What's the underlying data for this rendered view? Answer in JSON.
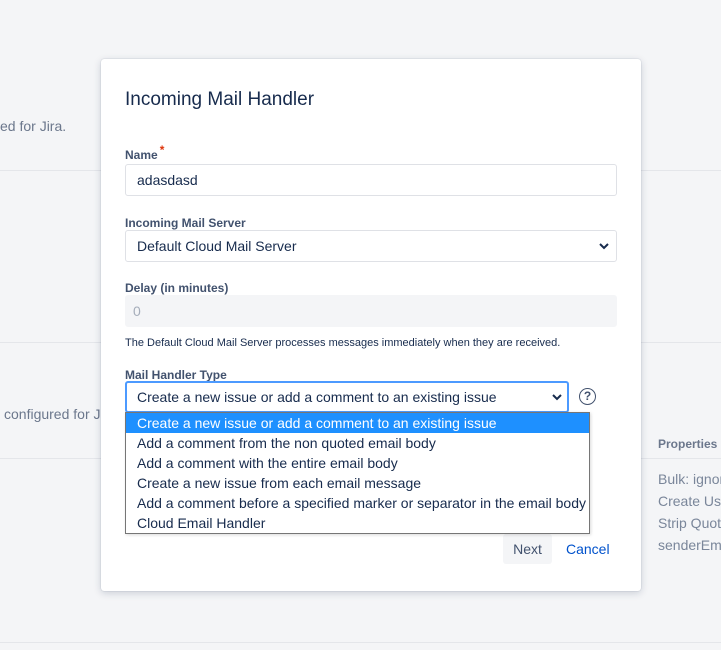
{
  "background": {
    "snippet1": "ed for Jira.",
    "snippet2": "configured for J",
    "properties": {
      "header": "Properties",
      "rows": [
        "Bulk: ignor",
        "Create Use",
        "Strip Quot",
        "senderEma"
      ]
    }
  },
  "dialog": {
    "title": "Incoming Mail Handler",
    "name": {
      "label": "Name",
      "required_marker": "*",
      "value": "adasdasd"
    },
    "server": {
      "label": "Incoming Mail Server",
      "value": "Default Cloud Mail Server"
    },
    "delay": {
      "label": "Delay (in minutes)",
      "value": "0"
    },
    "help_text": "The Default Cloud Mail Server processes messages immediately when they are received.",
    "handler_type": {
      "label": "Mail Handler Type",
      "value": "Create a new issue or add a comment to an existing issue",
      "options": [
        "Create a new issue or add a comment to an existing issue",
        "Add a comment from the non quoted email body",
        "Add a comment with the entire email body",
        "Create a new issue from each email message",
        "Add a comment before a specified marker or separator in the email body",
        "Cloud Email Handler"
      ],
      "selected_index": 0
    },
    "help_icon": "question-circle-icon",
    "next_label": "Next",
    "cancel_label": "Cancel"
  },
  "colors": {
    "accent": "#4c9aff",
    "selected_option": "#1e90ff",
    "link": "#0052cc",
    "required": "#de350b"
  }
}
